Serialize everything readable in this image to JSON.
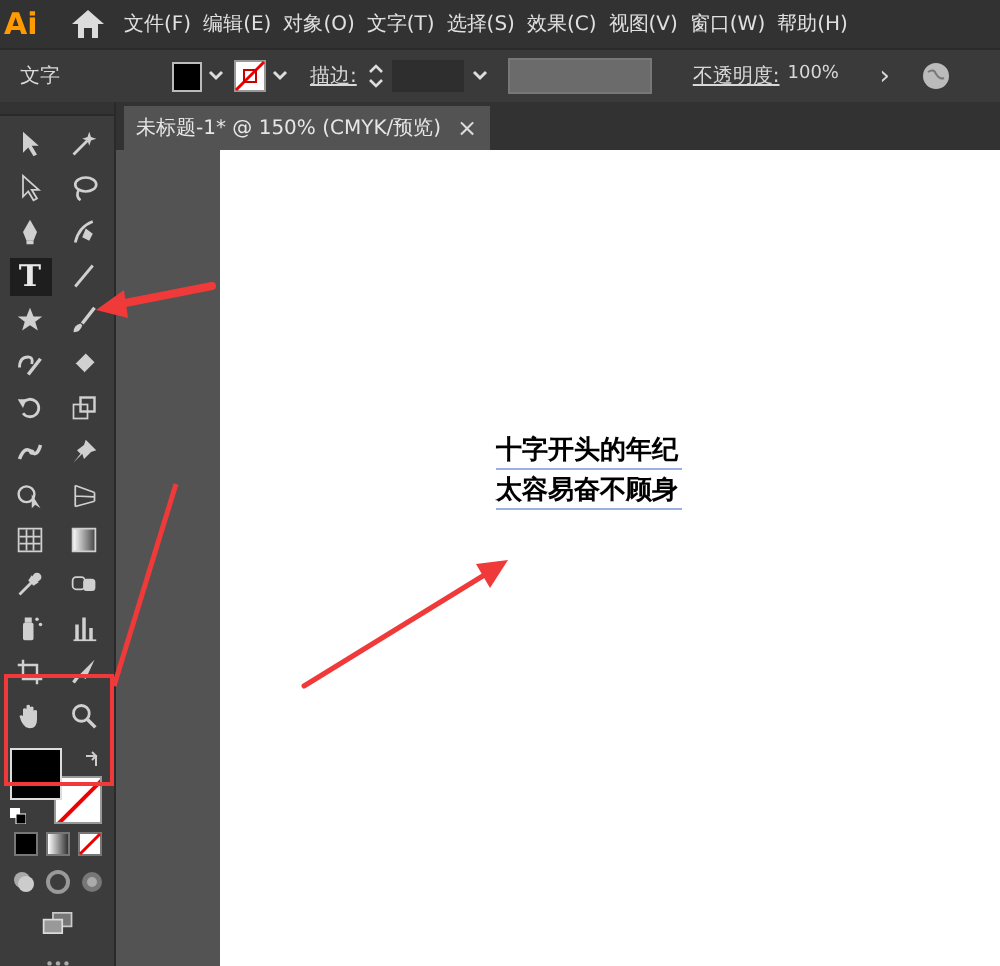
{
  "app_logo": "Ai",
  "menu": [
    "文件(F)",
    "编辑(E)",
    "对象(O)",
    "文字(T)",
    "选择(S)",
    "效果(C)",
    "视图(V)",
    "窗口(W)",
    "帮助(H)"
  ],
  "options_bar": {
    "label": "文字",
    "stroke_label": "描边:",
    "opacity_label": "不透明度:",
    "opacity_value": "100%",
    "more": "›"
  },
  "document_tab": {
    "title": "未标题-1* @ 150% (CMYK/预览)",
    "close": "×"
  },
  "tools": [
    {
      "kind": "selection",
      "selected": false
    },
    {
      "kind": "wand",
      "selected": false
    },
    {
      "kind": "direct",
      "selected": false
    },
    {
      "kind": "lasso",
      "selected": false
    },
    {
      "kind": "pen",
      "selected": false
    },
    {
      "kind": "brushpen",
      "selected": false
    },
    {
      "kind": "type",
      "label": "T",
      "selected": true
    },
    {
      "kind": "line",
      "selected": false
    },
    {
      "kind": "star",
      "selected": false
    },
    {
      "kind": "brush",
      "selected": false
    },
    {
      "kind": "shaper",
      "selected": false
    },
    {
      "kind": "eraser",
      "selected": false
    },
    {
      "kind": "rotate",
      "selected": false
    },
    {
      "kind": "scale",
      "selected": false
    },
    {
      "kind": "warp",
      "selected": false
    },
    {
      "kind": "pin",
      "selected": false
    },
    {
      "kind": "builder",
      "selected": false
    },
    {
      "kind": "perspective",
      "selected": false
    },
    {
      "kind": "mesh",
      "selected": false
    },
    {
      "kind": "gradient",
      "selected": false
    },
    {
      "kind": "eyedropper",
      "selected": false
    },
    {
      "kind": "blend",
      "selected": false
    },
    {
      "kind": "symbol",
      "selected": false
    },
    {
      "kind": "graph",
      "selected": false
    },
    {
      "kind": "artboard",
      "selected": false
    },
    {
      "kind": "slice",
      "selected": false
    },
    {
      "kind": "hand",
      "selected": false
    },
    {
      "kind": "zoom",
      "selected": false
    }
  ],
  "canvas_text": [
    "十字开头的年纪",
    "太容易奋不顾身"
  ]
}
